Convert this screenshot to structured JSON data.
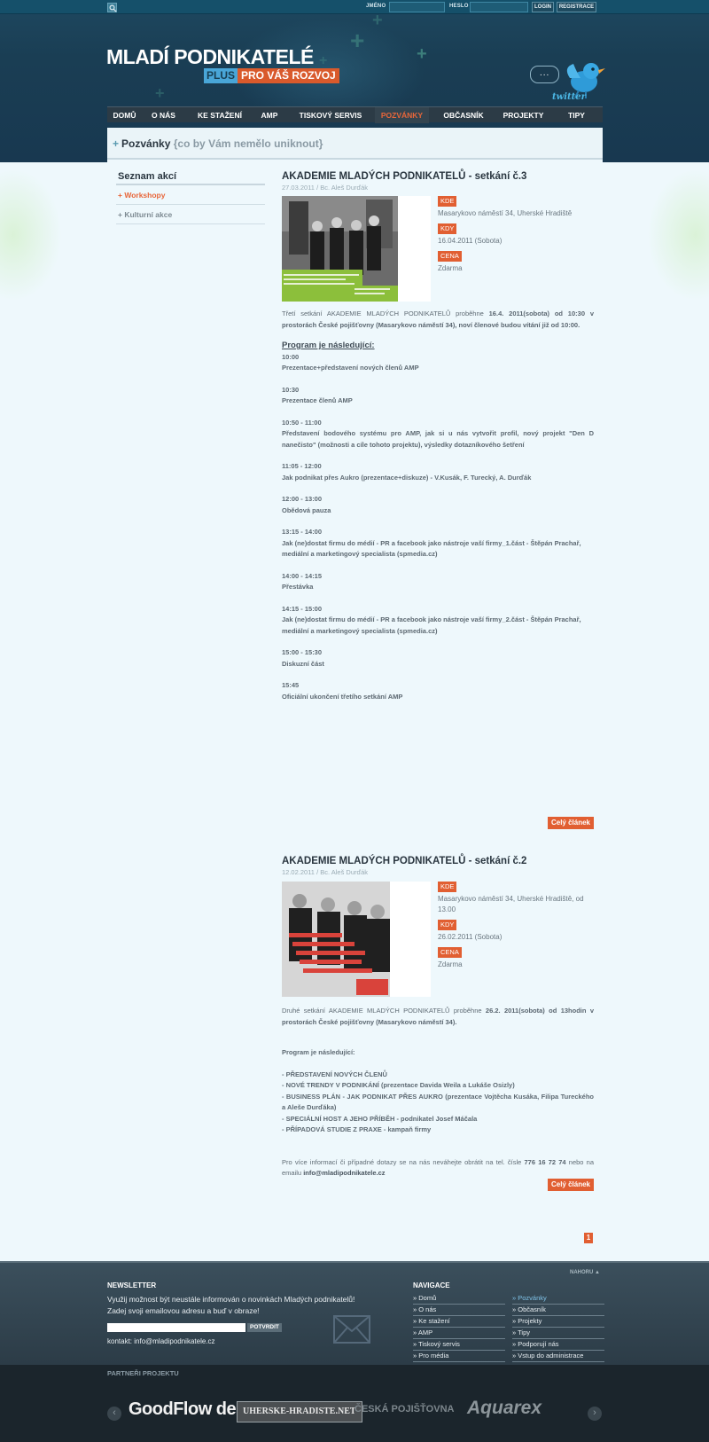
{
  "topbar": {
    "username_label": "JMÉNO",
    "password_label": "HESLO",
    "login_label": "LOGIN",
    "register_label": "REGISTRACE"
  },
  "logo": {
    "title": "MLADÍ PODNIKATELÉ",
    "plus": "PLUS",
    "subtitle": "PRO VÁŠ ROZVOJ"
  },
  "twitter": {
    "label": "twitter",
    "bubble": "..."
  },
  "nav": {
    "items": [
      {
        "label": "DOMŮ"
      },
      {
        "label": "O NÁS"
      },
      {
        "label": "KE STAŽENÍ"
      },
      {
        "label": "AMP"
      },
      {
        "label": "TISKOVÝ SERVIS"
      },
      {
        "label": "POZVÁNKY"
      },
      {
        "label": "OBČASNÍK"
      },
      {
        "label": "PROJEKTY"
      },
      {
        "label": "TIPY"
      }
    ],
    "active_index": 5
  },
  "page": {
    "title": "Pozvánky",
    "subtitle": "{co by Vám nemělo uniknout}"
  },
  "sidebar": {
    "title": "Seznam akcí",
    "items": [
      {
        "label": "+ Workshopy"
      },
      {
        "label": "+ Kulturní akce"
      }
    ]
  },
  "articles": [
    {
      "title": "AKADEMIE MLADÝCH PODNIKATELŮ - setkání č.3",
      "meta": "27.03.2011 / Bc. Aleš Durďák",
      "kde_label": "KDE",
      "kde": "Masarykovo náměstí 34, Uherské Hradiště",
      "kdy_label": "KDY",
      "kdy": "16.04.2011 (Sobota)",
      "cena_label": "CENA",
      "cena": "Zdarma",
      "intro_a": "Třetí setkání AKADEMIE MLADÝCH PODNIKATELŮ proběhne ",
      "intro_b": "16.4. 2011(sobota) od 10:30 v prostorách České pojišťovny (Masarykovo náměstí 34), noví členové budou vítání již od 10:00.",
      "program_heading": "Program je následující:",
      "program": [
        {
          "time": "10:00",
          "text": "Prezentace+představení nových členů AMP"
        },
        {
          "time": "10:30",
          "text": "Prezentace členů AMP"
        },
        {
          "time": "10:50 - 11:00",
          "text": "Představení bodového systému pro AMP, jak si u nás vytvořit profil, nový projekt \"Den D nanečisto\" (možnosti a cíle tohoto projektu), výsledky dotazníkového šetření"
        },
        {
          "time": "11:05 - 12:00",
          "text": "Jak podnikat přes Aukro (prezentace+diskuze) - V.Kusák, F. Turecký, A. Durďák"
        },
        {
          "time": "12:00 - 13:00",
          "text": "Obědová pauza"
        },
        {
          "time": "13:15 - 14:00",
          "text": "Jak (ne)dostat firmu do médií - PR  a facebook jako nástroje vaší firmy_1.část - Štěpán Prachař, mediální a marketingový specialista (spmedia.cz)"
        },
        {
          "time": "14:00 - 14:15",
          "text": "Přestávka"
        },
        {
          "time": "14:15 - 15:00",
          "text": "Jak (ne)dostat firmu do médií - PR  a facebook jako nástroje vaší firmy_2.část - Štěpán Prachař, mediální a marketingový specialista (spmedia.cz)"
        },
        {
          "time": "15:00 - 15:30",
          "text": "Diskuzní část"
        },
        {
          "time": "15:45",
          "text": "Oficiální ukončení třetího setkání AMP"
        }
      ],
      "more_label": "Celý článek"
    },
    {
      "title": "AKADEMIE MLADÝCH PODNIKATELŮ - setkání č.2",
      "meta": "12.02.2011 / Bc. Aleš Durďák",
      "kde_label": "KDE",
      "kde": "Masarykovo náměstí 34, Uherské Hradiště, od 13.00",
      "kdy_label": "KDY",
      "kdy": "26.02.2011 (Sobota)",
      "cena_label": "CENA",
      "cena": "Zdarma",
      "intro_a": "Druhé setkání AKADEMIE MLADÝCH PODNIKATELŮ proběhne ",
      "intro_b": "26.2. 2011(sobota) od 13hodin v prostorách České pojišťovny (Masarykovo náměstí 34).",
      "program_heading": "Program je následující:",
      "program_items": [
        "- PŘEDSTAVENÍ NOVÝCH ČLENŮ",
        "- NOVÉ TRENDY V PODNIKÁNÍ (prezentace Davida Weila a Lukáše Osizly)",
        "- BUSINESS PLÁN - JAK PODNIKAT PŘES AUKRO (prezentace Vojtěcha Kusáka, Filipa Tureckého a Aleše Durďáka)",
        "- SPECIÁLNÍ HOST A JEHO PŘÍBĚH - podnikatel Josef Máčala",
        "- PŘÍPADOVÁ STUDIE Z PRAXE - kampaň firmy"
      ],
      "contact_a": "Pro více informací či případné dotazy se na nás neváhejte obrátit na tel. čísle ",
      "contact_phone": "776 16 72 74",
      "contact_b": " nebo na emailu ",
      "contact_email": "info@mladipodnikatele.cz",
      "more_label": "Celý článek"
    }
  ],
  "pagination": {
    "current": "1"
  },
  "footer": {
    "nahoru": "NAHORU ▲",
    "newsletter_title": "NEWSLETTER",
    "newsletter_text": "Využij možnost být neustále informován o novinkách Mladých podnikatelů! Zadej svoji emailovou adresu a buď v obraze!",
    "newsletter_button": "POTVRDIT",
    "contact": "kontakt: info@mladipodnikatele.cz",
    "nav_title": "NAVIGACE",
    "nav_left": [
      "» Domů",
      "» O nás",
      "» Ke stažení",
      "» AMP",
      "» Tiskový servis",
      "» Pro média"
    ],
    "nav_right": [
      "» Pozvánky",
      "» Občasník",
      "» Projekty",
      "» Tipy",
      "» Podporují nás",
      "» Vstup do administrace"
    ]
  },
  "partners": {
    "title": "PARTNEŘI PROJEKTU",
    "logos": [
      "GoodFlow design",
      "UHERSKE-HRADISTE.NET",
      "ČESKÁ POJIŠŤOVNA",
      "Aquarex"
    ]
  },
  "colors": {
    "accent": "#e15f32",
    "header_bg": "#1a3e54",
    "page_bg": "#eef8fc",
    "footer_bg": "#34474f"
  }
}
